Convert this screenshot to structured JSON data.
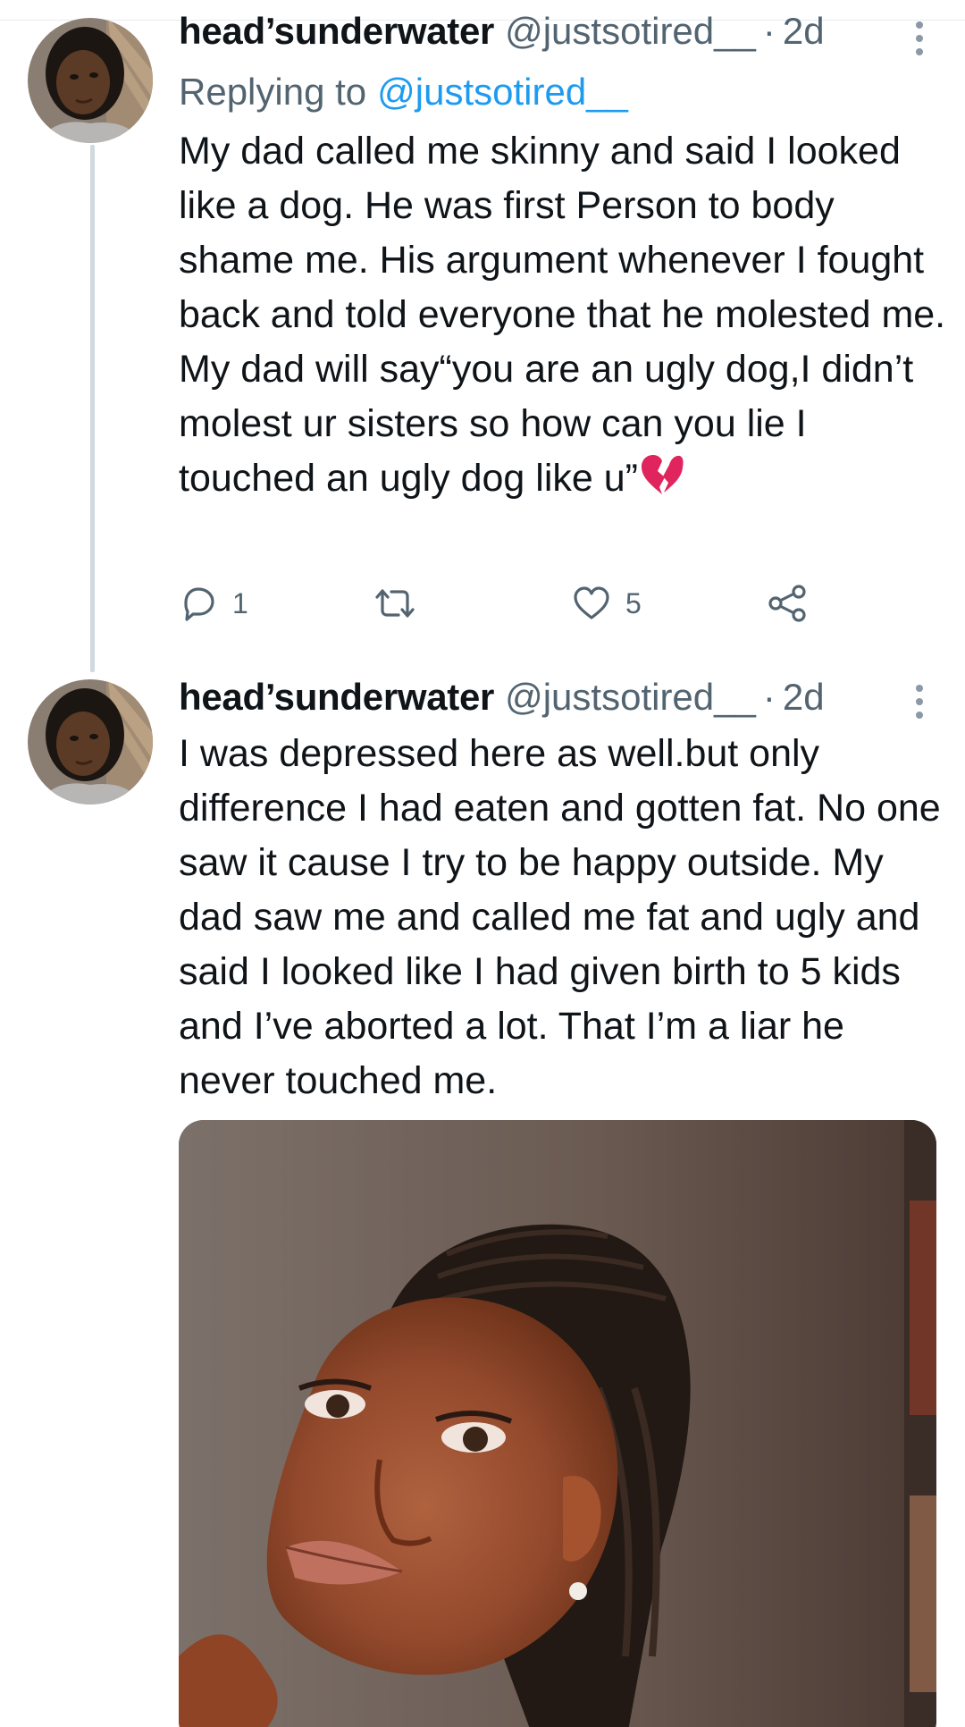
{
  "tweets": [
    {
      "author_name": "head’sunderwater",
      "handle": "@justsotired__",
      "separator": "·",
      "time": "2d",
      "reply_label": "Replying to",
      "reply_handle": "@justsotired__",
      "text": "My dad called me skinny and said I looked like a dog. He was first Person to body shame me. His argument whenever I fought back and told everyone that he molested me. My dad will say“you are an ugly dog,I didn’t molest ur sisters so how can you lie I touched an ugly dog like u”",
      "trailing_emoji": "broken-heart",
      "actions": {
        "reply_count": "1",
        "retweet_count": "",
        "like_count": "5"
      }
    },
    {
      "author_name": "head’sunderwater",
      "handle": "@justsotired__",
      "separator": "·",
      "time": "2d",
      "text": "I was depressed here as well.but only difference I had eaten and gotten fat. No one saw it cause I try to be happy outside. My dad saw me and called me fat and ugly and said I looked like I had given birth to 5 kids and I’ve aborted a lot. That I’m a liar he never touched me.",
      "media": "photo"
    }
  ],
  "icons": {
    "reply": "reply-icon",
    "retweet": "retweet-icon",
    "like": "heart-icon",
    "share": "share-icon",
    "more": "more-vertical-icon",
    "emoji": "broken-heart-icon"
  },
  "colors": {
    "text_primary": "#0f1419",
    "text_secondary": "#536471",
    "link": "#1d9bf0",
    "thread_line": "#cfd9de",
    "emoji_red": "#e0245e"
  }
}
